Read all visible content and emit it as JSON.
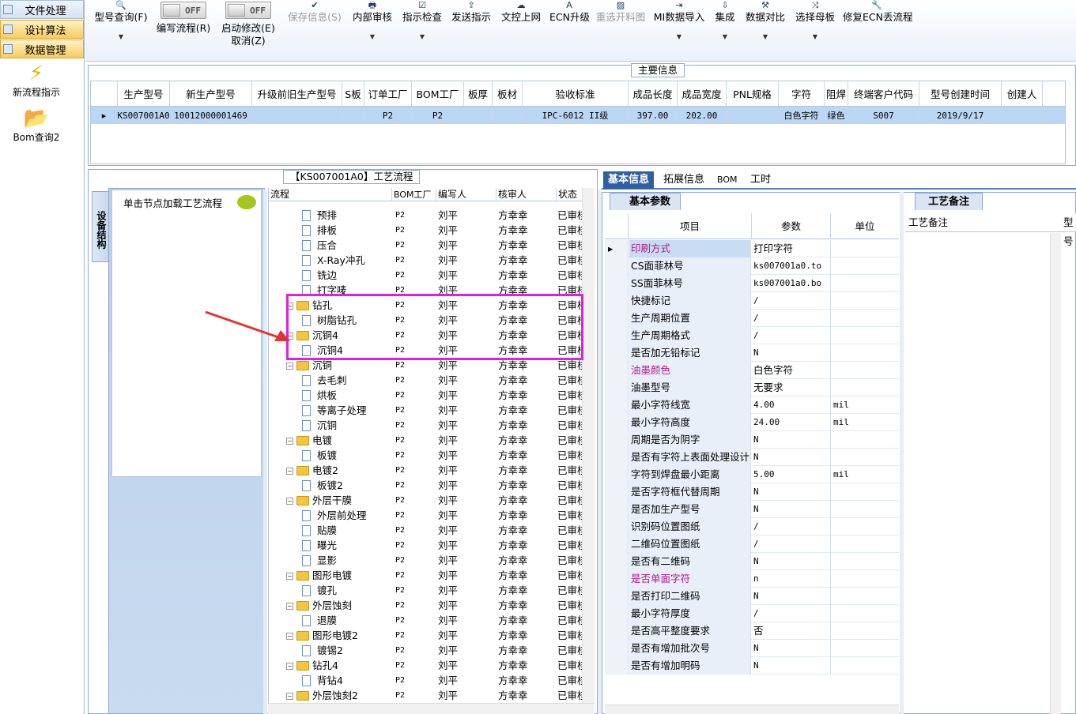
{
  "leftnav": {
    "tabs": [
      {
        "label": "文件处理",
        "active": false
      },
      {
        "label": "设计算法",
        "active": true
      },
      {
        "label": "数据管理",
        "active": true
      }
    ],
    "launchers": [
      {
        "label": "新流程指示",
        "icon": "lightning-icon"
      },
      {
        "label": "Bom查询2",
        "icon": "folder-icon"
      }
    ]
  },
  "toolbar": {
    "model_query": "型号查询(F)",
    "edit_flow": "编写流程(R)",
    "start_modify": "启动修改(E)",
    "cancel": "取消(Z)",
    "toggle_off": "OFF",
    "save_info": "保存信息(S)",
    "internal_review": "内部审核",
    "indicator_check": "指示检查",
    "send_indicator": "发送指示",
    "doc_online": "文控上网",
    "ecn_upgrade": "ECN升级",
    "reselect_material": "重选开料图",
    "mi_import": "MI数据导入",
    "integrate": "集成",
    "data_compare": "数据对比",
    "select_mother": "选择母板",
    "repair_ecn": "修复ECN丢流程"
  },
  "main_info": {
    "title": "主要信息",
    "columns": [
      "生产型号",
      "新生产型号",
      "升级前旧生产型号",
      "S板",
      "订单工厂",
      "BOM工厂",
      "板厚",
      "板材",
      "验收标准",
      "成品长度",
      "成品宽度",
      "PNL规格",
      "字符",
      "阻焊",
      "终端客户代码",
      "型号创建时间",
      "创建人"
    ],
    "row": [
      "KS007001A0",
      "10012000001469",
      "",
      "",
      "P2",
      "P2",
      "",
      "",
      "IPC-6012 II级",
      "397.00",
      "202.00",
      "",
      "白色字符",
      "绿色",
      "S007",
      "2019/9/17",
      ""
    ]
  },
  "process": {
    "title": "【KS007001A0】工艺流程",
    "side_tab": "设备结构",
    "hint": "单击节点加载工艺流程",
    "columns": {
      "flow": "流程",
      "bom": "BOM工厂",
      "writer": "编写人",
      "auditor": "核审人",
      "status": "状态"
    },
    "rows": [
      {
        "name": "预排",
        "type": "doc",
        "bom": "P2",
        "writer": "刘平",
        "auditor": "方幸幸",
        "status": "已审核"
      },
      {
        "name": "排板",
        "type": "doc",
        "bom": "P2",
        "writer": "刘平",
        "auditor": "方幸幸",
        "status": "已审核"
      },
      {
        "name": "压合",
        "type": "doc",
        "bom": "P2",
        "writer": "刘平",
        "auditor": "方幸幸",
        "status": "已审核"
      },
      {
        "name": "X-Ray冲孔",
        "type": "doc",
        "bom": "P2",
        "writer": "刘平",
        "auditor": "方幸幸",
        "status": "已审核"
      },
      {
        "name": "铣边",
        "type": "doc",
        "bom": "P2",
        "writer": "刘平",
        "auditor": "方幸幸",
        "status": "已审核"
      },
      {
        "name": "打字唛",
        "type": "doc",
        "bom": "P2",
        "writer": "刘平",
        "auditor": "方幸幸",
        "status": "已审核"
      },
      {
        "name": "钻孔",
        "type": "folder",
        "bom": "P2",
        "writer": "刘平",
        "auditor": "方幸幸",
        "status": "已审核"
      },
      {
        "name": "树脂钻孔",
        "type": "doc",
        "bom": "P2",
        "writer": "刘平",
        "auditor": "方幸幸",
        "status": "已审核"
      },
      {
        "name": "沉铜4",
        "type": "folder",
        "bom": "P2",
        "writer": "刘平",
        "auditor": "方幸幸",
        "status": "已审核"
      },
      {
        "name": "沉铜4",
        "type": "doc",
        "bom": "P2",
        "writer": "刘平",
        "auditor": "方幸幸",
        "status": "已审核"
      },
      {
        "name": "沉铜",
        "type": "folder",
        "bom": "P2",
        "writer": "刘平",
        "auditor": "方幸幸",
        "status": "已审核"
      },
      {
        "name": "去毛刺",
        "type": "doc",
        "bom": "P2",
        "writer": "刘平",
        "auditor": "方幸幸",
        "status": "已审核"
      },
      {
        "name": "烘板",
        "type": "doc",
        "bom": "P2",
        "writer": "刘平",
        "auditor": "方幸幸",
        "status": "已审核"
      },
      {
        "name": "等离子处理",
        "type": "doc",
        "bom": "P2",
        "writer": "刘平",
        "auditor": "方幸幸",
        "status": "已审核"
      },
      {
        "name": "沉铜",
        "type": "doc",
        "bom": "P2",
        "writer": "刘平",
        "auditor": "方幸幸",
        "status": "已审核"
      },
      {
        "name": "电镀",
        "type": "folder",
        "bom": "P2",
        "writer": "刘平",
        "auditor": "方幸幸",
        "status": "已审核"
      },
      {
        "name": "板镀",
        "type": "doc",
        "bom": "P2",
        "writer": "刘平",
        "auditor": "方幸幸",
        "status": "已审核"
      },
      {
        "name": "电镀2",
        "type": "folder",
        "bom": "P2",
        "writer": "刘平",
        "auditor": "方幸幸",
        "status": "已审核"
      },
      {
        "name": "板镀2",
        "type": "doc",
        "bom": "P2",
        "writer": "刘平",
        "auditor": "方幸幸",
        "status": "已审核"
      },
      {
        "name": "外层干膜",
        "type": "folder",
        "bom": "P2",
        "writer": "刘平",
        "auditor": "方幸幸",
        "status": "已审核"
      },
      {
        "name": "外层前处理",
        "type": "doc",
        "bom": "P2",
        "writer": "刘平",
        "auditor": "方幸幸",
        "status": "已审核"
      },
      {
        "name": "贴膜",
        "type": "doc",
        "bom": "P2",
        "writer": "刘平",
        "auditor": "方幸幸",
        "status": "已审核"
      },
      {
        "name": "曝光",
        "type": "doc",
        "bom": "P2",
        "writer": "刘平",
        "auditor": "方幸幸",
        "status": "已审核"
      },
      {
        "name": "显影",
        "type": "doc",
        "bom": "P2",
        "writer": "刘平",
        "auditor": "方幸幸",
        "status": "已审核"
      },
      {
        "name": "图形电镀",
        "type": "folder",
        "bom": "P2",
        "writer": "刘平",
        "auditor": "方幸幸",
        "status": "已审核"
      },
      {
        "name": "镀孔",
        "type": "doc",
        "bom": "P2",
        "writer": "刘平",
        "auditor": "方幸幸",
        "status": "已审核"
      },
      {
        "name": "外层蚀刻",
        "type": "folder",
        "bom": "P2",
        "writer": "刘平",
        "auditor": "方幸幸",
        "status": "已审核"
      },
      {
        "name": "退膜",
        "type": "doc",
        "bom": "P2",
        "writer": "刘平",
        "auditor": "方幸幸",
        "status": "已审核"
      },
      {
        "name": "图形电镀2",
        "type": "folder",
        "bom": "P2",
        "writer": "刘平",
        "auditor": "方幸幸",
        "status": "已审核"
      },
      {
        "name": "镀锡2",
        "type": "doc",
        "bom": "P2",
        "writer": "刘平",
        "auditor": "方幸幸",
        "status": "已审核"
      },
      {
        "name": "钻孔4",
        "type": "folder",
        "bom": "P2",
        "writer": "刘平",
        "auditor": "方幸幸",
        "status": "已审核"
      },
      {
        "name": "背钻4",
        "type": "doc",
        "bom": "P2",
        "writer": "刘平",
        "auditor": "方幸幸",
        "status": "已审核"
      },
      {
        "name": "外层蚀刻2",
        "type": "folder",
        "bom": "P2",
        "writer": "刘平",
        "auditor": "方幸幸",
        "status": "已审核"
      }
    ]
  },
  "right": {
    "tabs": [
      "基本信息",
      "拓展信息",
      "BOM",
      "工时"
    ],
    "param_tab": "基本参数",
    "param_columns": {
      "item": "项目",
      "param": "参数",
      "unit": "单位"
    },
    "params": [
      {
        "item": "印刷方式",
        "value": "打印字符",
        "unit": "",
        "pink": true,
        "selected": true
      },
      {
        "item": "CS面菲林号",
        "value": "ks007001a0.to",
        "unit": "",
        "pink": false
      },
      {
        "item": "SS面菲林号",
        "value": "ks007001a0.bo",
        "unit": "",
        "pink": false
      },
      {
        "item": "快捷标记",
        "value": "/",
        "unit": "",
        "pink": false
      },
      {
        "item": "生产周期位置",
        "value": "/",
        "unit": "",
        "pink": false
      },
      {
        "item": "生产周期格式",
        "value": "/",
        "unit": "",
        "pink": false
      },
      {
        "item": "是否加无铅标记",
        "value": "N",
        "unit": "",
        "pink": false
      },
      {
        "item": "油墨颜色",
        "value": "白色字符",
        "unit": "",
        "pink": true
      },
      {
        "item": "油墨型号",
        "value": "无要求",
        "unit": "",
        "pink": false
      },
      {
        "item": "最小字符线宽",
        "value": "4.00",
        "unit": "mil",
        "pink": false
      },
      {
        "item": "最小字符高度",
        "value": "24.00",
        "unit": "mil",
        "pink": false
      },
      {
        "item": "周期是否为阴字",
        "value": "N",
        "unit": "",
        "pink": false
      },
      {
        "item": "是否有字符上表面处理设计",
        "value": "N",
        "unit": "",
        "pink": false
      },
      {
        "item": "字符到焊盘最小距离",
        "value": "5.00",
        "unit": "mil",
        "pink": false
      },
      {
        "item": "是否字符框代替周期",
        "value": "N",
        "unit": "",
        "pink": false
      },
      {
        "item": "是否加生产型号",
        "value": "N",
        "unit": "",
        "pink": false
      },
      {
        "item": "识别码位置图纸",
        "value": "/",
        "unit": "",
        "pink": false
      },
      {
        "item": "二维码位置图纸",
        "value": "/",
        "unit": "",
        "pink": false
      },
      {
        "item": "是否有二维码",
        "value": "N",
        "unit": "",
        "pink": false
      },
      {
        "item": "是否单面字符",
        "value": "n",
        "unit": "",
        "pink": true
      },
      {
        "item": "是否打印二维码",
        "value": "N",
        "unit": "",
        "pink": false
      },
      {
        "item": "最小字符厚度",
        "value": "/",
        "unit": "",
        "pink": false
      },
      {
        "item": "是否高平整度要求",
        "value": "否",
        "unit": "",
        "pink": false
      },
      {
        "item": "是否有增加批次号",
        "value": "N",
        "unit": "",
        "pink": false
      },
      {
        "item": "是否有增加明码",
        "value": "N",
        "unit": "",
        "pink": false
      }
    ],
    "note_tab": "工艺备注",
    "note_col": "工艺备注",
    "note_col2": "型号"
  },
  "colors": {
    "highlight": "#e020e0",
    "arrow": "#e53333",
    "selected_row": "#bcd7f4",
    "pink_label": "#b0198b",
    "active_tab": "#2e5fa0"
  }
}
